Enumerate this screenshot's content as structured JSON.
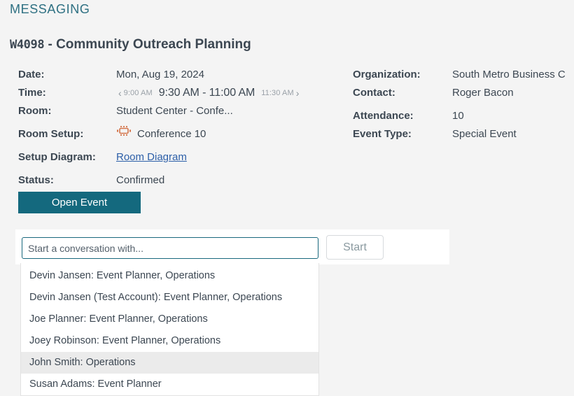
{
  "header": {
    "section_label": "MESSAGING"
  },
  "event": {
    "code": "W4098",
    "separator": " - ",
    "name": "Community Outreach Planning",
    "title_full": "W4098 - Community Outreach Planning"
  },
  "details": {
    "left": {
      "date_label": "Date:",
      "date_value": "Mon, Aug 19, 2024",
      "time_label": "Time:",
      "time_prev": "9:00 AM",
      "time_current": "9:30 AM - 11:00 AM",
      "time_next": "11:30 AM",
      "prev_icon": "chevron-left-icon",
      "next_icon": "chevron-right-icon",
      "room_label": "Room:",
      "room_value": "Student Center - Confe...",
      "room_setup_label": "Room Setup:",
      "room_setup_value": "Conference 10",
      "room_setup_icon": "conference-table-icon",
      "setup_diagram_label": "Setup Diagram:",
      "setup_diagram_link": "Room Diagram",
      "status_label": "Status:",
      "status_value": "Confirmed"
    },
    "right": {
      "organization_label": "Organization:",
      "organization_value": "South Metro Business C",
      "contact_label": "Contact:",
      "contact_value": "Roger Bacon",
      "attendance_label": "Attendance:",
      "attendance_value": "10",
      "event_type_label": "Event Type:",
      "event_type_value": "Special Event"
    }
  },
  "actions": {
    "open_event_label": "Open Event"
  },
  "conversation": {
    "input_value": "",
    "input_placeholder": "Start a conversation with...",
    "start_label": "Start"
  },
  "dropdown": {
    "items": [
      {
        "label": "Devin Jansen: Event Planner, Operations",
        "highlighted": false
      },
      {
        "label": "Devin Jansen (Test Account): Event Planner, Operations",
        "highlighted": false
      },
      {
        "label": "Joe Planner: Event Planner, Operations",
        "highlighted": false
      },
      {
        "label": "Joey Robinson: Event Planner, Operations",
        "highlighted": false
      },
      {
        "label": "John Smith: Operations",
        "highlighted": true
      },
      {
        "label": "Susan Adams: Event Planner",
        "highlighted": false
      }
    ]
  },
  "colors": {
    "page_background": "#f4f4f4",
    "teal_accent": "#14697e",
    "header_teal": "#2e7082",
    "link_blue": "#2c5fa8",
    "setup_icon_orange": "#d4744a",
    "text_primary": "#3c4752",
    "highlight_row": "#ebebeb"
  }
}
